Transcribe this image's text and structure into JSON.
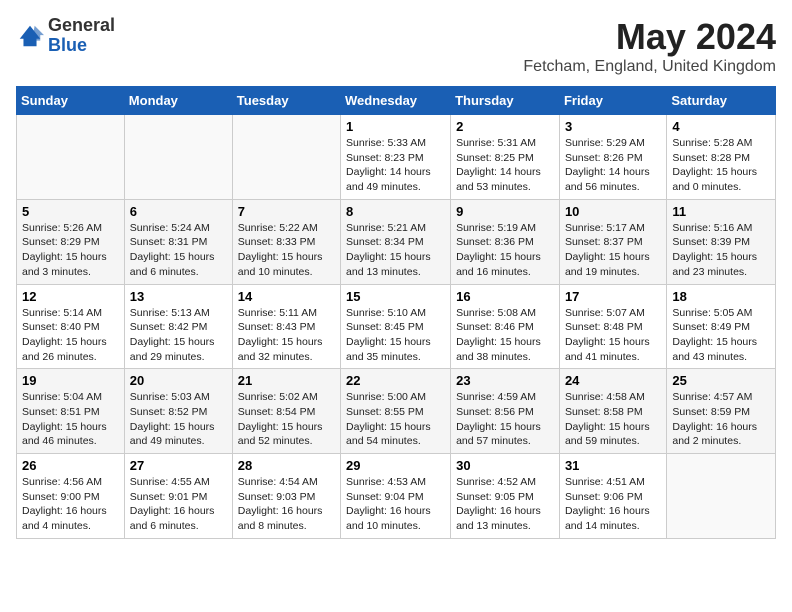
{
  "logo": {
    "general": "General",
    "blue": "Blue"
  },
  "header": {
    "month_year": "May 2024",
    "location": "Fetcham, England, United Kingdom"
  },
  "days_of_week": [
    "Sunday",
    "Monday",
    "Tuesday",
    "Wednesday",
    "Thursday",
    "Friday",
    "Saturday"
  ],
  "weeks": [
    [
      {
        "day": "",
        "sunrise": "",
        "sunset": "",
        "daylight": ""
      },
      {
        "day": "",
        "sunrise": "",
        "sunset": "",
        "daylight": ""
      },
      {
        "day": "",
        "sunrise": "",
        "sunset": "",
        "daylight": ""
      },
      {
        "day": "1",
        "sunrise": "Sunrise: 5:33 AM",
        "sunset": "Sunset: 8:23 PM",
        "daylight": "Daylight: 14 hours and 49 minutes."
      },
      {
        "day": "2",
        "sunrise": "Sunrise: 5:31 AM",
        "sunset": "Sunset: 8:25 PM",
        "daylight": "Daylight: 14 hours and 53 minutes."
      },
      {
        "day": "3",
        "sunrise": "Sunrise: 5:29 AM",
        "sunset": "Sunset: 8:26 PM",
        "daylight": "Daylight: 14 hours and 56 minutes."
      },
      {
        "day": "4",
        "sunrise": "Sunrise: 5:28 AM",
        "sunset": "Sunset: 8:28 PM",
        "daylight": "Daylight: 15 hours and 0 minutes."
      }
    ],
    [
      {
        "day": "5",
        "sunrise": "Sunrise: 5:26 AM",
        "sunset": "Sunset: 8:29 PM",
        "daylight": "Daylight: 15 hours and 3 minutes."
      },
      {
        "day": "6",
        "sunrise": "Sunrise: 5:24 AM",
        "sunset": "Sunset: 8:31 PM",
        "daylight": "Daylight: 15 hours and 6 minutes."
      },
      {
        "day": "7",
        "sunrise": "Sunrise: 5:22 AM",
        "sunset": "Sunset: 8:33 PM",
        "daylight": "Daylight: 15 hours and 10 minutes."
      },
      {
        "day": "8",
        "sunrise": "Sunrise: 5:21 AM",
        "sunset": "Sunset: 8:34 PM",
        "daylight": "Daylight: 15 hours and 13 minutes."
      },
      {
        "day": "9",
        "sunrise": "Sunrise: 5:19 AM",
        "sunset": "Sunset: 8:36 PM",
        "daylight": "Daylight: 15 hours and 16 minutes."
      },
      {
        "day": "10",
        "sunrise": "Sunrise: 5:17 AM",
        "sunset": "Sunset: 8:37 PM",
        "daylight": "Daylight: 15 hours and 19 minutes."
      },
      {
        "day": "11",
        "sunrise": "Sunrise: 5:16 AM",
        "sunset": "Sunset: 8:39 PM",
        "daylight": "Daylight: 15 hours and 23 minutes."
      }
    ],
    [
      {
        "day": "12",
        "sunrise": "Sunrise: 5:14 AM",
        "sunset": "Sunset: 8:40 PM",
        "daylight": "Daylight: 15 hours and 26 minutes."
      },
      {
        "day": "13",
        "sunrise": "Sunrise: 5:13 AM",
        "sunset": "Sunset: 8:42 PM",
        "daylight": "Daylight: 15 hours and 29 minutes."
      },
      {
        "day": "14",
        "sunrise": "Sunrise: 5:11 AM",
        "sunset": "Sunset: 8:43 PM",
        "daylight": "Daylight: 15 hours and 32 minutes."
      },
      {
        "day": "15",
        "sunrise": "Sunrise: 5:10 AM",
        "sunset": "Sunset: 8:45 PM",
        "daylight": "Daylight: 15 hours and 35 minutes."
      },
      {
        "day": "16",
        "sunrise": "Sunrise: 5:08 AM",
        "sunset": "Sunset: 8:46 PM",
        "daylight": "Daylight: 15 hours and 38 minutes."
      },
      {
        "day": "17",
        "sunrise": "Sunrise: 5:07 AM",
        "sunset": "Sunset: 8:48 PM",
        "daylight": "Daylight: 15 hours and 41 minutes."
      },
      {
        "day": "18",
        "sunrise": "Sunrise: 5:05 AM",
        "sunset": "Sunset: 8:49 PM",
        "daylight": "Daylight: 15 hours and 43 minutes."
      }
    ],
    [
      {
        "day": "19",
        "sunrise": "Sunrise: 5:04 AM",
        "sunset": "Sunset: 8:51 PM",
        "daylight": "Daylight: 15 hours and 46 minutes."
      },
      {
        "day": "20",
        "sunrise": "Sunrise: 5:03 AM",
        "sunset": "Sunset: 8:52 PM",
        "daylight": "Daylight: 15 hours and 49 minutes."
      },
      {
        "day": "21",
        "sunrise": "Sunrise: 5:02 AM",
        "sunset": "Sunset: 8:54 PM",
        "daylight": "Daylight: 15 hours and 52 minutes."
      },
      {
        "day": "22",
        "sunrise": "Sunrise: 5:00 AM",
        "sunset": "Sunset: 8:55 PM",
        "daylight": "Daylight: 15 hours and 54 minutes."
      },
      {
        "day": "23",
        "sunrise": "Sunrise: 4:59 AM",
        "sunset": "Sunset: 8:56 PM",
        "daylight": "Daylight: 15 hours and 57 minutes."
      },
      {
        "day": "24",
        "sunrise": "Sunrise: 4:58 AM",
        "sunset": "Sunset: 8:58 PM",
        "daylight": "Daylight: 15 hours and 59 minutes."
      },
      {
        "day": "25",
        "sunrise": "Sunrise: 4:57 AM",
        "sunset": "Sunset: 8:59 PM",
        "daylight": "Daylight: 16 hours and 2 minutes."
      }
    ],
    [
      {
        "day": "26",
        "sunrise": "Sunrise: 4:56 AM",
        "sunset": "Sunset: 9:00 PM",
        "daylight": "Daylight: 16 hours and 4 minutes."
      },
      {
        "day": "27",
        "sunrise": "Sunrise: 4:55 AM",
        "sunset": "Sunset: 9:01 PM",
        "daylight": "Daylight: 16 hours and 6 minutes."
      },
      {
        "day": "28",
        "sunrise": "Sunrise: 4:54 AM",
        "sunset": "Sunset: 9:03 PM",
        "daylight": "Daylight: 16 hours and 8 minutes."
      },
      {
        "day": "29",
        "sunrise": "Sunrise: 4:53 AM",
        "sunset": "Sunset: 9:04 PM",
        "daylight": "Daylight: 16 hours and 10 minutes."
      },
      {
        "day": "30",
        "sunrise": "Sunrise: 4:52 AM",
        "sunset": "Sunset: 9:05 PM",
        "daylight": "Daylight: 16 hours and 13 minutes."
      },
      {
        "day": "31",
        "sunrise": "Sunrise: 4:51 AM",
        "sunset": "Sunset: 9:06 PM",
        "daylight": "Daylight: 16 hours and 14 minutes."
      },
      {
        "day": "",
        "sunrise": "",
        "sunset": "",
        "daylight": ""
      }
    ]
  ]
}
